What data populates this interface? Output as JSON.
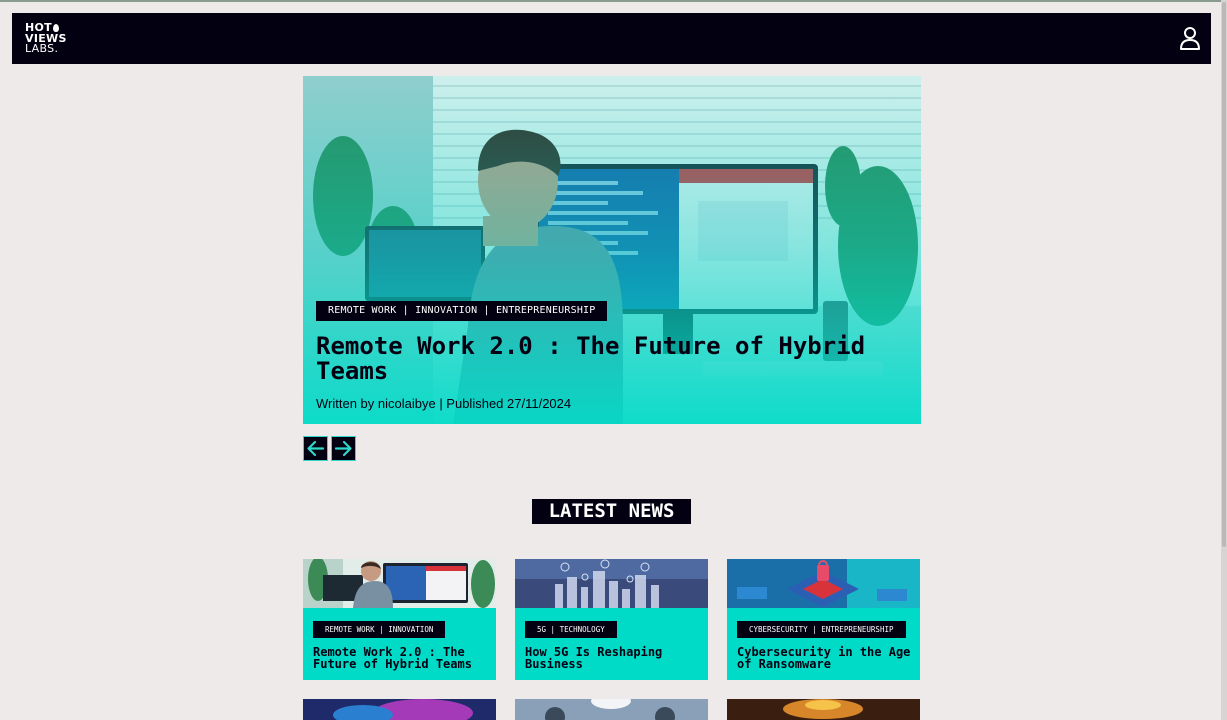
{
  "brand": {
    "line1": "HOT",
    "line2": "VIEWS",
    "line3": "LABS."
  },
  "hero": {
    "tags": "REMOTE WORK | INNOVATION | ENTREPRENEURSHIP",
    "title": "Remote Work 2.0 : The Future of Hybrid Teams",
    "byline": "Written by nicolaibye | Published 27/11/2024"
  },
  "section": {
    "title": "LATEST NEWS"
  },
  "cards": [
    {
      "tag": "REMOTE WORK | INNOVATION",
      "title": "Remote Work 2.0 : The Future of Hybrid Teams"
    },
    {
      "tag": "5G | TECHNOLOGY",
      "title": "How 5G Is Reshaping Business"
    },
    {
      "tag": "CYBERSECURITY | ENTREPRENEURSHIP",
      "title": "Cybersecurity in the Age of Ransomware"
    }
  ],
  "icons": {
    "user": "user-icon",
    "prev": "arrow-left-icon",
    "next": "arrow-right-icon"
  },
  "colors": {
    "nav_bg": "#030111",
    "accent": "#00dbc8",
    "page_bg": "#efeaea"
  }
}
